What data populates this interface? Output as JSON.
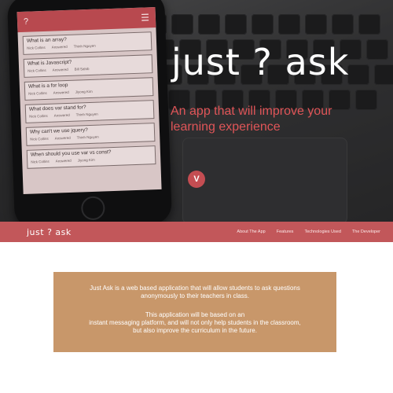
{
  "hero": {
    "title": "just ? ask",
    "subtitle": "An app that will improve your learning experience",
    "scroll_button": "V"
  },
  "phone": {
    "app_logo": "?",
    "menu_icon": "menu-icon",
    "questions": [
      {
        "text": "What is an array?",
        "meta": [
          "Nick Collins",
          "Answered",
          "Thinh Nguyen"
        ]
      },
      {
        "text": "What is Javascript?",
        "meta": [
          "Nick Collins",
          "Answered",
          "Bill Sahib"
        ]
      },
      {
        "text": "What is a for loop",
        "meta": [
          "Nick Collins",
          "Answered",
          "Jiyong Kim"
        ]
      },
      {
        "text": "What does var stand for?",
        "meta": [
          "Nick Collins",
          "Answered",
          "Thinh Nguyen"
        ]
      },
      {
        "text": "Why can't we use jquery?",
        "meta": [
          "Nick Collins",
          "Answered",
          "Thinh Nguyen"
        ]
      },
      {
        "text": "When should you use var vs const?",
        "meta": [
          "Nick Collins",
          "Answered",
          "Jiyong Kim"
        ]
      }
    ]
  },
  "navbar": {
    "brand": "just ? ask",
    "links": [
      "About The App",
      "Features",
      "Technologies Used",
      "The Developer"
    ]
  },
  "about": {
    "line1": "Just Ask is a web based application that will allow students  to ask questions",
    "line2": "anonymously to their teachers in class.",
    "line3": "This application will be based on an",
    "line4": "instant messaging  platform, and will not only help students in the classroom,",
    "line5": "but also improve the curriculum in the future."
  },
  "colors": {
    "accent": "#c2575a",
    "subtitle": "#e05558",
    "about_bg": "#c8976a"
  }
}
